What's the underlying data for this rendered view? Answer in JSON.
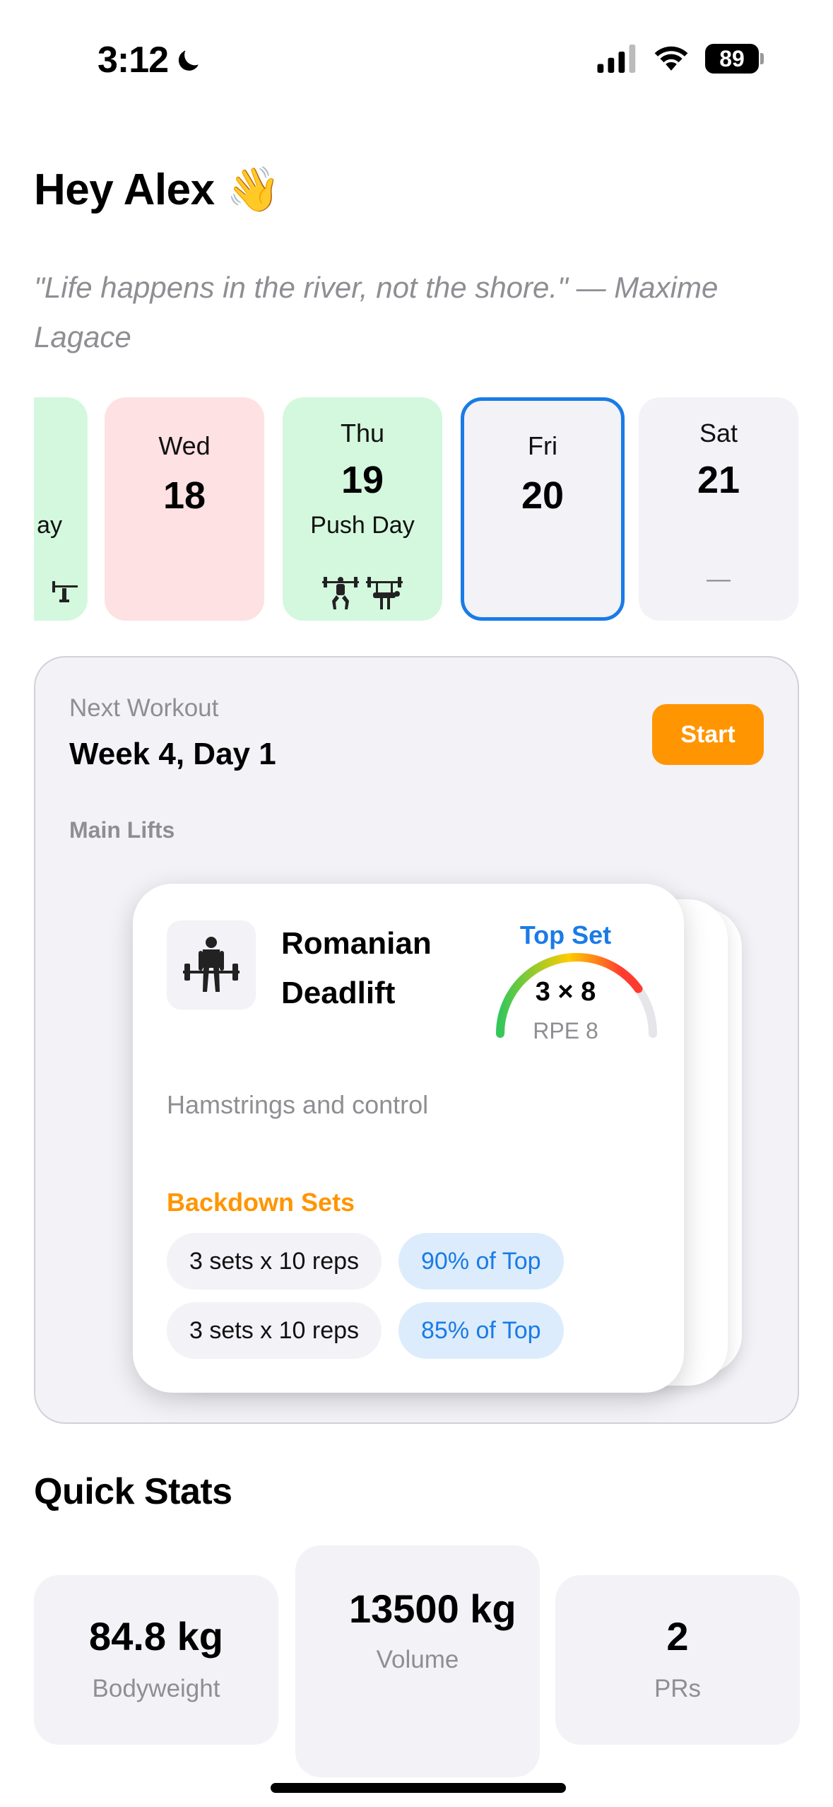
{
  "status_bar": {
    "time": "3:12",
    "battery": "89"
  },
  "greeting": "Hey Alex 👋",
  "quote": "\"Life happens in the river, not the shore.\" — Maxime Lagace",
  "days": {
    "prev": {
      "label": "ay"
    },
    "wed": {
      "name": "Wed",
      "num": "18"
    },
    "thu": {
      "name": "Thu",
      "num": "19",
      "label": "Push Day"
    },
    "fri": {
      "name": "Fri",
      "num": "20"
    },
    "sat": {
      "name": "Sat",
      "num": "21",
      "placeholder": "—"
    }
  },
  "next_workout": {
    "label": "Next Workout",
    "title": "Week 4, Day 1",
    "start_label": "Start",
    "main_lifts_label": "Main Lifts"
  },
  "lift": {
    "name": "Romanian Deadlift",
    "top_set_label": "Top Set",
    "top_set_value": "3 × 8",
    "top_set_rpe": "RPE 8",
    "gauge_fraction": 0.8,
    "description": "Hamstrings and control",
    "backdown_label": "Backdown Sets",
    "backdown_sets": [
      {
        "sets": "3 sets x 10 reps",
        "percent": "90% of Top"
      },
      {
        "sets": "3 sets x 10 reps",
        "percent": "85% of Top"
      }
    ]
  },
  "quick_stats": {
    "title": "Quick Stats",
    "items": [
      {
        "value": "84.8 kg",
        "label": "Bodyweight"
      },
      {
        "value": "13500 kg",
        "label": "Volume"
      },
      {
        "value": "2",
        "label": "PRs"
      }
    ]
  },
  "colors": {
    "accent_blue": "#1a7be6",
    "accent_orange": "#ff9500",
    "success_green": "#d3f8dd",
    "missed_red": "#fde1e3"
  },
  "icons": [
    "moon-icon",
    "signal-icon",
    "wifi-icon",
    "squat-icon",
    "bench-icon",
    "deadlift-icon"
  ]
}
